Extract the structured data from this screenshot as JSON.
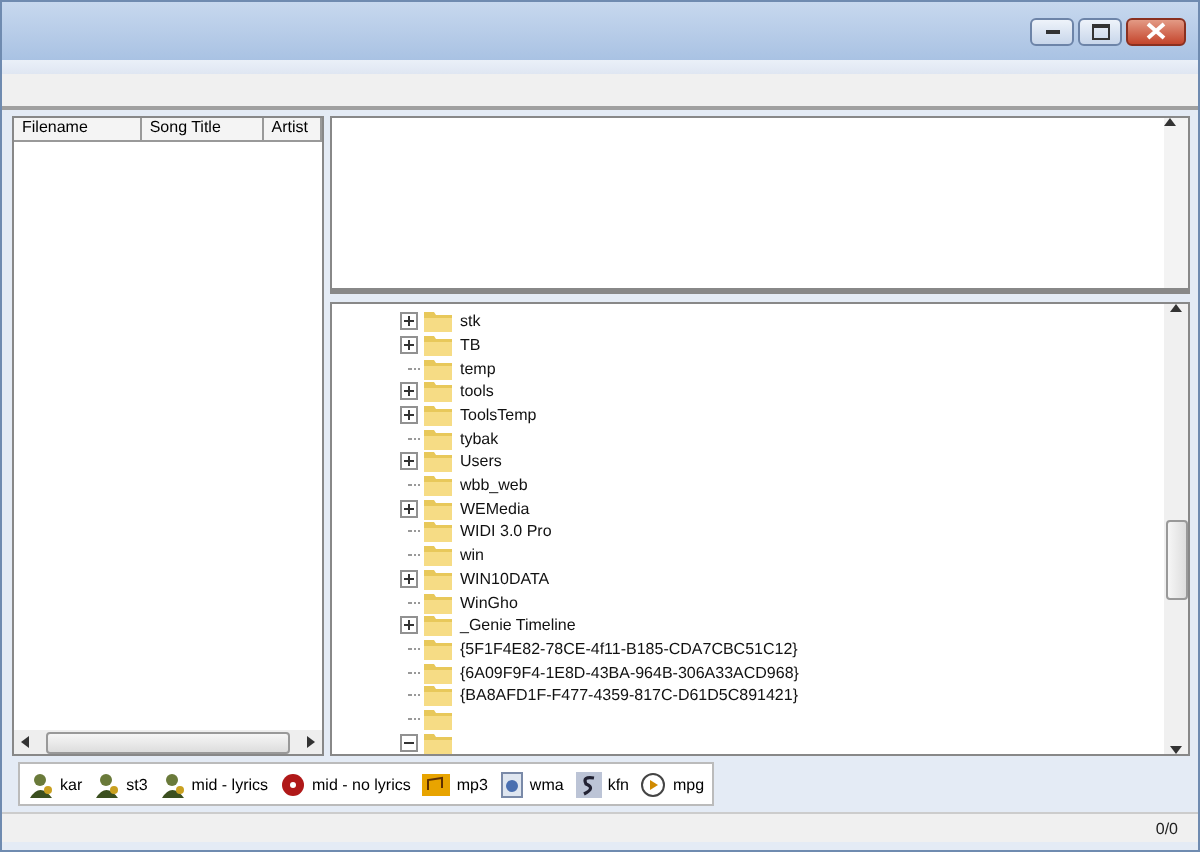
{
  "file_list": {
    "columns": [
      "Filename",
      "Song Title",
      "Artist"
    ]
  },
  "folder_tree": [
    {
      "label": "stk",
      "kind": "collapsed"
    },
    {
      "label": "TB",
      "kind": "collapsed"
    },
    {
      "label": "temp",
      "kind": "leaf"
    },
    {
      "label": "tools",
      "kind": "collapsed"
    },
    {
      "label": "ToolsTemp",
      "kind": "collapsed"
    },
    {
      "label": "tybak",
      "kind": "leaf"
    },
    {
      "label": "Users",
      "kind": "collapsed"
    },
    {
      "label": "wbb_web",
      "kind": "leaf"
    },
    {
      "label": "WEMedia",
      "kind": "collapsed"
    },
    {
      "label": "WIDI 3.0 Pro",
      "kind": "leaf"
    },
    {
      "label": "win",
      "kind": "leaf"
    },
    {
      "label": "WIN10DATA",
      "kind": "collapsed"
    },
    {
      "label": "WinGho",
      "kind": "leaf"
    },
    {
      "label": "_Genie Timeline",
      "kind": "collapsed"
    },
    {
      "label": "{5F1F4E82-78CE-4f11-B185-CDA7CBC51C12}",
      "kind": "leaf"
    },
    {
      "label": "{6A09F9F4-1E8D-43BA-964B-306A33ACD968}",
      "kind": "leaf"
    },
    {
      "label": "{BA8AFD1F-F477-4359-817C-D61D5C891421}",
      "kind": "leaf"
    },
    {
      "kind": "leaf"
    },
    {
      "kind": "expanded"
    }
  ],
  "format_tabs": [
    {
      "label": "kar",
      "kind": "karaoke"
    },
    {
      "label": "st3",
      "kind": "karaoke"
    },
    {
      "label": "mid - lyrics",
      "kind": "karaoke"
    },
    {
      "label": "mid - no lyrics",
      "kind": "disc"
    },
    {
      "label": "mp3",
      "kind": "mp3"
    },
    {
      "label": "wma",
      "kind": "media"
    },
    {
      "label": "kfn",
      "kind": "kfn"
    },
    {
      "label": "mpg",
      "kind": "video"
    }
  ],
  "status_bar": {
    "count": "0/0"
  }
}
